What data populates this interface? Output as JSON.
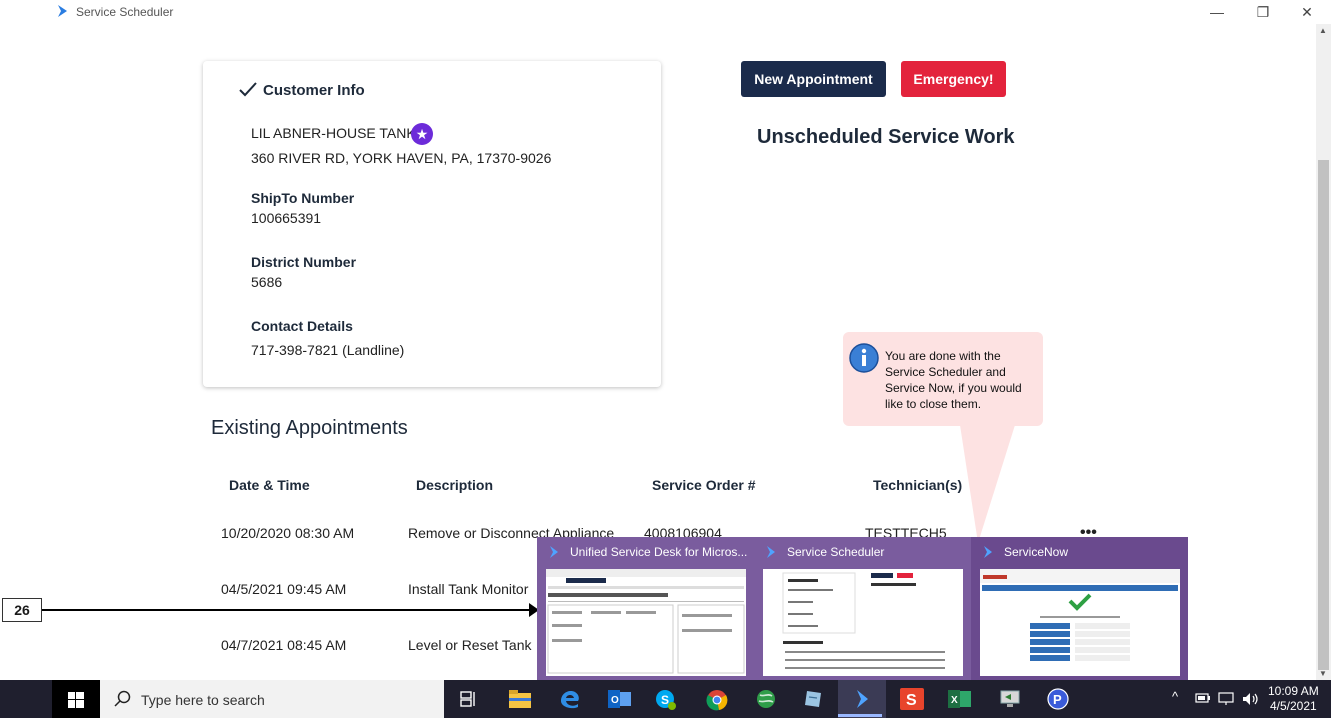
{
  "window": {
    "title": "Service Scheduler",
    "minimize": "—",
    "restore": "❐",
    "close": "✕"
  },
  "customer_info": {
    "heading": "Customer Info",
    "name": "LIL ABNER-HOUSE TANK",
    "address": "360 RIVER RD, YORK HAVEN, PA, 17370-9026",
    "shipto_label": "ShipTo Number",
    "shipto_value": "100665391",
    "district_label": "District Number",
    "district_value": "5686",
    "contact_label": "Contact Details",
    "contact_value": "717-398-7821 (Landline)"
  },
  "actions": {
    "new_appointment": "New Appointment",
    "emergency": "Emergency!"
  },
  "unscheduled_title": "Unscheduled Service Work",
  "appointments": {
    "title": "Existing Appointments",
    "headers": [
      "Date & Time",
      "Description",
      "Service Order #",
      "Technician(s)"
    ],
    "rows": [
      {
        "date": "10/20/2020 08:30 AM",
        "description": "Remove or Disconnect Appliance",
        "order": "4008106904",
        "tech": "TESTTECH5"
      },
      {
        "date": "04/5/2021 09:45 AM",
        "description": "Install Tank Monitor",
        "order": "",
        "tech": ""
      },
      {
        "date": "04/7/2021 08:45 AM",
        "description": "Level or Reset Tank",
        "order": "",
        "tech": ""
      }
    ],
    "more": "•••"
  },
  "tooltip": {
    "text": "You are done with the Service Scheduler and Service Now, if you would like to close them."
  },
  "step_number": "26",
  "switcher": {
    "windows": [
      {
        "title": "Unified Service Desk for Micros..."
      },
      {
        "title": "Service Scheduler"
      },
      {
        "title": "ServiceNow"
      }
    ]
  },
  "taskbar": {
    "search_placeholder": "Type here to search",
    "time": "10:09 AM",
    "date": "4/5/2021",
    "tray_chevron": "^"
  },
  "colors": {
    "navy": "#1b2b4b",
    "red": "#e3233c",
    "purple": "#7a5c9e",
    "tooltip": "#fde2e2"
  }
}
